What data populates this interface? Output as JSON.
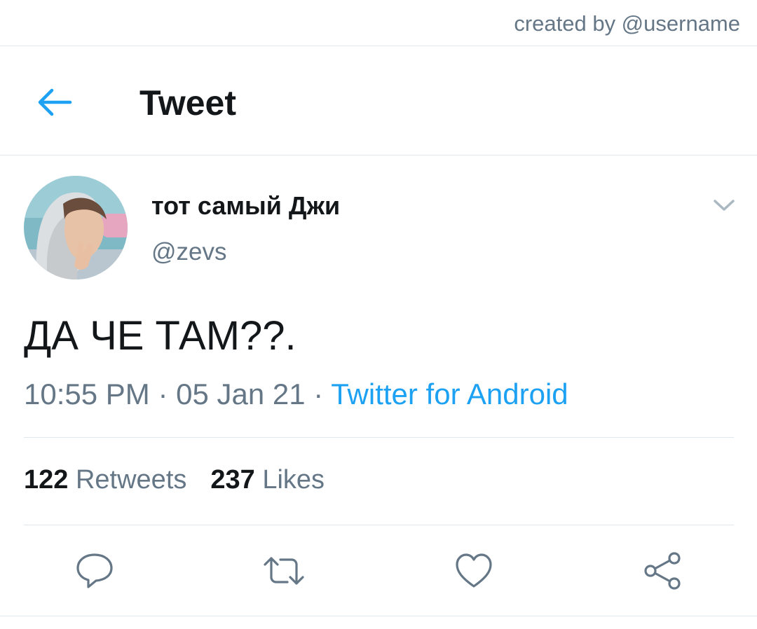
{
  "credit": "created by @username",
  "header": {
    "title": "Tweet",
    "back_icon": "arrow-left-icon",
    "accent": "#1da1f2"
  },
  "tweet": {
    "display_name": "тот самый Джи",
    "handle": "@zevs",
    "text": "ДА ЧЕ ТАМ??.",
    "time": "10:55 PM",
    "sep1": " · ",
    "date": "05 Jan 21",
    "sep2": " · ",
    "source": "Twitter for Android"
  },
  "stats": {
    "retweets_count": "122",
    "retweets_label": "Retweets",
    "likes_count": "237",
    "likes_label": "Likes"
  },
  "actions": [
    "reply-icon",
    "retweet-icon",
    "like-icon",
    "share-icon"
  ],
  "colors": {
    "text": "#14171a",
    "secondary": "#657786",
    "link": "#1da1f2",
    "border": "#e1e8ed"
  }
}
